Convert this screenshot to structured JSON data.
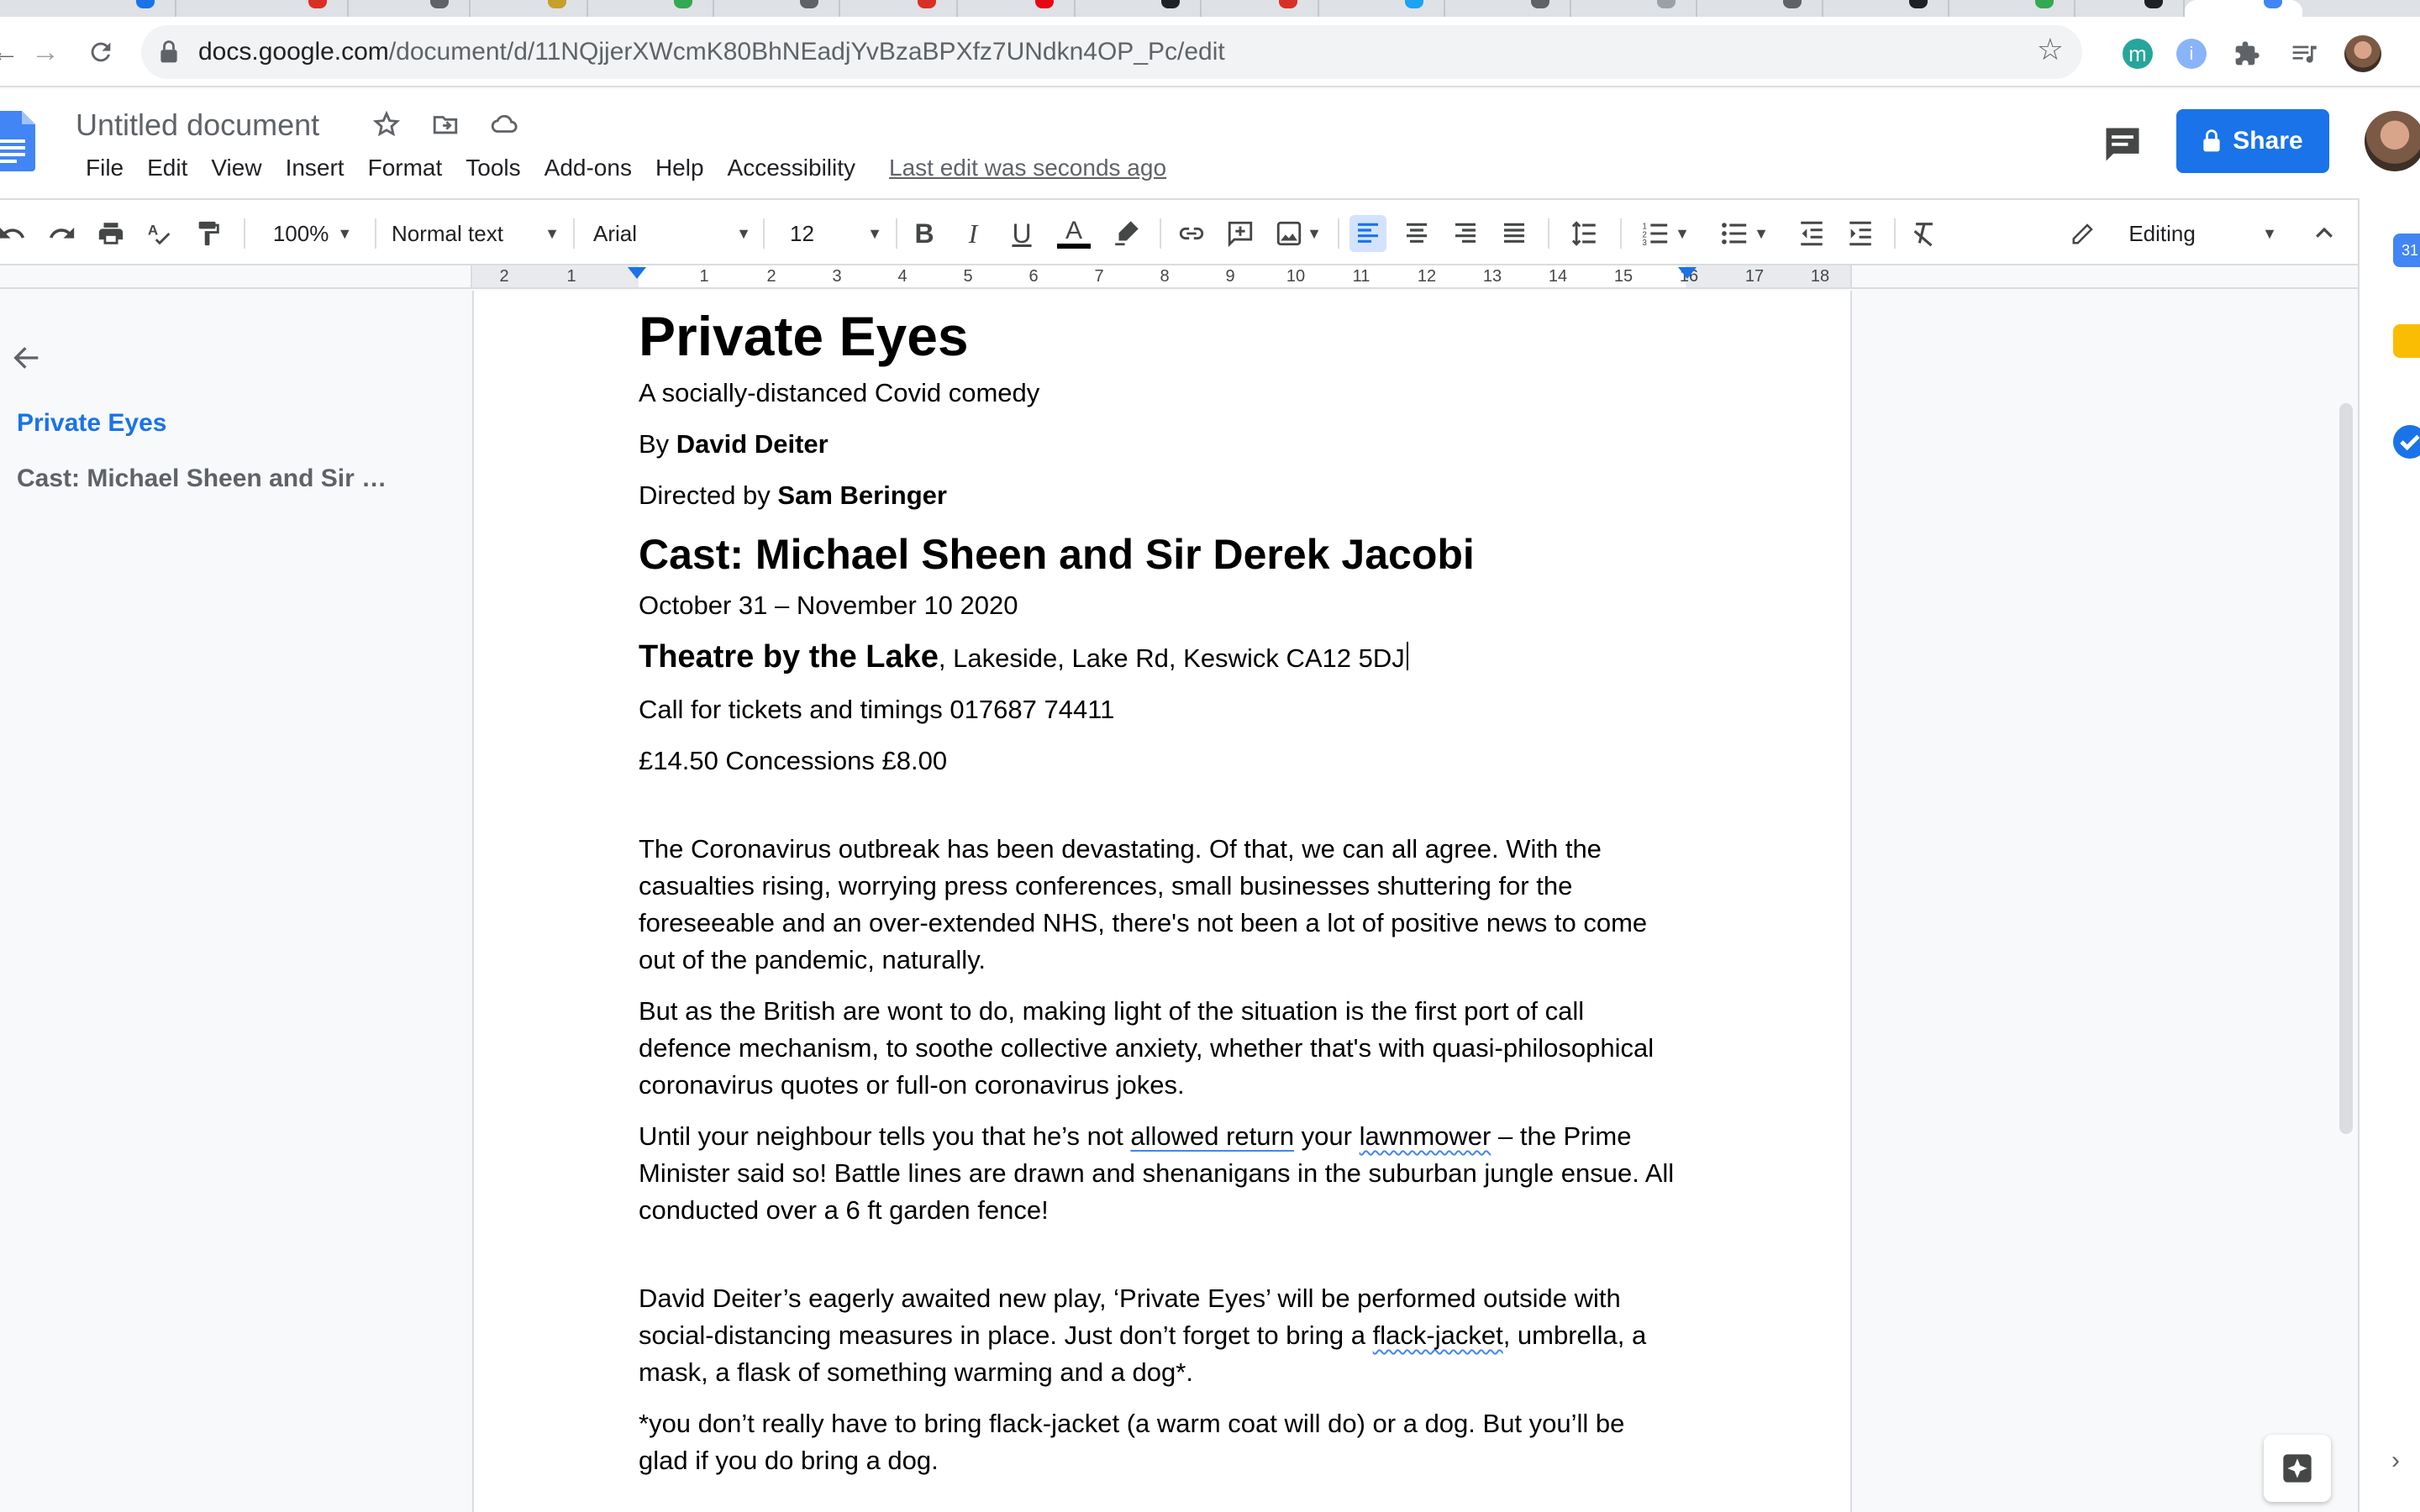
{
  "browser": {
    "url_host": "docs.google.com",
    "url_path": "/document/d/11NQjjerXWcmK80BhNEadjYvBzaBPXfz7UNdkn4OP_Pc/edit"
  },
  "header": {
    "doc_title": "Untitled document",
    "menu": [
      "File",
      "Edit",
      "View",
      "Insert",
      "Format",
      "Tools",
      "Add-ons",
      "Help",
      "Accessibility"
    ],
    "last_edit": "Last edit was seconds ago",
    "share_label": "Share"
  },
  "toolbar": {
    "zoom": "100%",
    "style": "Normal text",
    "font": "Arial",
    "size": "12",
    "mode": "Editing"
  },
  "ruler": {
    "numbers": [
      "2",
      "1",
      "1",
      "2",
      "3",
      "4",
      "5",
      "6",
      "7",
      "8",
      "9",
      "10",
      "11",
      "12",
      "13",
      "14",
      "15",
      "16",
      "17",
      "18"
    ]
  },
  "outline": {
    "items": [
      "Private Eyes",
      "Cast: Michael Sheen and Sir …"
    ]
  },
  "document": {
    "title": "Private Eyes",
    "subtitle": "A socially-distanced Covid comedy",
    "by_prefix": "By ",
    "author": "David Deiter",
    "directed_prefix": "Directed by ",
    "director": "Sam Beringer",
    "cast_heading": "Cast: Michael Sheen and Sir Derek Jacobi",
    "dates": "October 31 – November 10 2020",
    "venue_name": "Theatre by the Lake",
    "venue_address": ", Lakeside, Lake Rd, Keswick CA12 5DJ",
    "tickets": "Call for tickets and timings 017687 74411",
    "prices": "£14.50 Concessions £8.00",
    "para1": "The Coronavirus outbreak has been devastating. Of that, we can all agree. With the casualties rising, worrying press conferences, small businesses shuttering for the foreseeable and an over-extended NHS, there's not been a lot of positive news to come out of the pandemic, naturally.",
    "para2": "But as the British are wont to do, making light of the situation is the first port of call defence mechanism, to soothe collective anxiety, whether that's with quasi-philosophical coronavirus quotes or full-on coronavirus jokes.",
    "para3_a": "Until your neighbour tells you that he’s not ",
    "para3_b": "allowed return",
    "para3_c": " your ",
    "para3_d": "lawnmower",
    "para3_e": " – the Prime Minister said so! Battle lines are drawn and shenanigans in the suburban jungle ensue. All conducted over a 6 ft garden fence!",
    "para4_a": "David Deiter’s eagerly awaited new play, ‘Private Eyes’ will be performed outside with social-distancing measures in place. Just don’t forget to bring a ",
    "para4_b": "flack-jacket",
    "para4_c": ", umbrella, a mask, a flask of something warming and a dog*.",
    "para5": "*you don’t really have to bring flack-jacket (a warm coat will do) or a dog. But you’ll be glad if you do bring a dog."
  }
}
